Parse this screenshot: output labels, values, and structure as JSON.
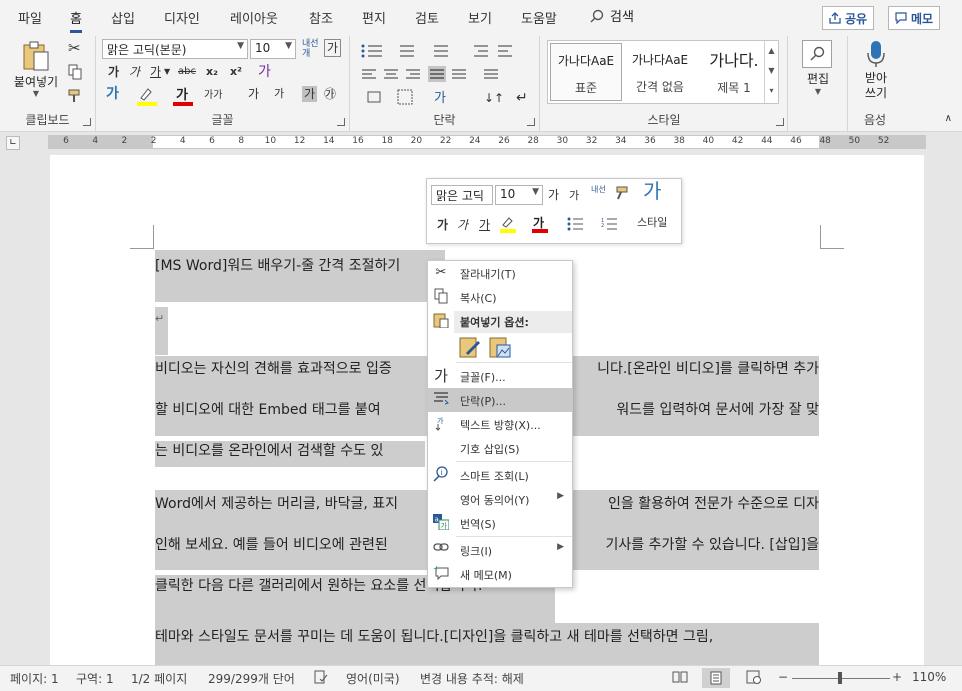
{
  "tabs": [
    "파일",
    "홈",
    "삽입",
    "디자인",
    "레이아웃",
    "참조",
    "편지",
    "검토",
    "보기",
    "도움말"
  ],
  "search_label": "검색",
  "share_label": "공유",
  "memo_label": "메모",
  "ribbon": {
    "clipboard": {
      "label": "클립보드",
      "paste_label": "붙여넣기"
    },
    "font": {
      "label": "글꼴",
      "font_name": "맑은 고딕(본문)",
      "font_size": "10",
      "bold": "가",
      "italic": "가",
      "underline": "가",
      "strike": "abc",
      "subscript": "x₂",
      "superscript": "x²",
      "text_effect": "가",
      "highlight_hint": "가가",
      "grow": "가",
      "shrink": "가",
      "shade": "가",
      "circle": "㉮"
    },
    "paragraph": {
      "label": "단락"
    },
    "styles": {
      "label": "스타일",
      "items": [
        {
          "preview": "가나다AaE",
          "name": "표준"
        },
        {
          "preview": "가나다AaE",
          "name": "간격 없음"
        },
        {
          "preview": "가나다.",
          "name": "제목 1"
        }
      ]
    },
    "editing": {
      "label": "편집"
    },
    "voice": {
      "label": "음성",
      "dictate_label": "받아쓰기"
    }
  },
  "ruler": {
    "numbers": [
      "6",
      "4",
      "2",
      "2",
      "4",
      "6",
      "8",
      "10",
      "12",
      "14",
      "16",
      "18",
      "20",
      "22",
      "24",
      "26",
      "28",
      "30",
      "32",
      "34",
      "36",
      "38",
      "40",
      "42",
      "44",
      "46",
      "48",
      "50",
      "52"
    ]
  },
  "document": {
    "lines": [
      "[MS Word]워드 배우기-줄 간격 조절하기",
      "↵",
      "비디오는 자신의 견해를 효과적으로 입증",
      "할 비디오에 대한 Embed 태그를 붙여",
      "는 비디오를 온라인에서 검색할 수도 있",
      "Word에서 제공하는 머리글, 바닥글, 표지",
      "인해 보세요. 예를 들어 비디오에 관련된",
      "클릭한 다음 다른 갤러리에서 원하는 요소를 선택합니다.",
      "테마와 스타일도 문서를 꾸미는 데 도움이 됩니다.[디자인]을 클릭하고 새 테마를 선택하면 그림,"
    ],
    "right_fragments": [
      "니다.[온라인 비디오]를 클릭하면 추가",
      "워드를 입력하여 문서에 가장 잘 맞",
      "인을 활용하여 전문가 수준으로 디자",
      "기사를 추가할 수 있습니다. [삽입]을"
    ]
  },
  "minitoolbar": {
    "font_name": "맑은 고딕",
    "font_size": "10",
    "styles_label": "스타일",
    "bold": "가",
    "italic": "가",
    "underline": "가",
    "grow": "가",
    "shrink": "가",
    "char_space": "내선"
  },
  "context_menu": {
    "items": [
      {
        "label": "잘라내기(T)",
        "icon": "scissors-icon"
      },
      {
        "label": "복사(C)",
        "icon": "copy-icon"
      },
      {
        "label": "붙여넣기 옵션:",
        "icon": "paste-icon"
      },
      {
        "label": "글꼴(F)...",
        "icon": "font-icon"
      },
      {
        "label": "단락(P)...",
        "icon": "paragraph-icon"
      },
      {
        "label": "텍스트 방향(X)...",
        "icon": "text-direction-icon"
      },
      {
        "label": "기호 삽입(S)",
        "icon": ""
      },
      {
        "label": "스마트 조회(L)",
        "icon": "smart-lookup-icon"
      },
      {
        "label": "영어 동의어(Y)",
        "icon": ""
      },
      {
        "label": "번역(S)",
        "icon": "translate-icon"
      },
      {
        "label": "링크(I)",
        "icon": "link-icon"
      },
      {
        "label": "새 메모(M)",
        "icon": "new-comment-icon"
      }
    ],
    "font_glyph": "가"
  },
  "status": {
    "page": "페이지: 1",
    "section": "구역: 1",
    "page_of": "1/2 페이지",
    "words": "299/299개 단어",
    "language": "영어(미국)",
    "track_changes": "변경 내용 추적: 해제",
    "zoom": "110%"
  },
  "colors": {
    "accent": "#2b579a",
    "highlight_yellow": "#ffff00",
    "font_red": "#e00000",
    "selection": "#cdcdcd"
  }
}
